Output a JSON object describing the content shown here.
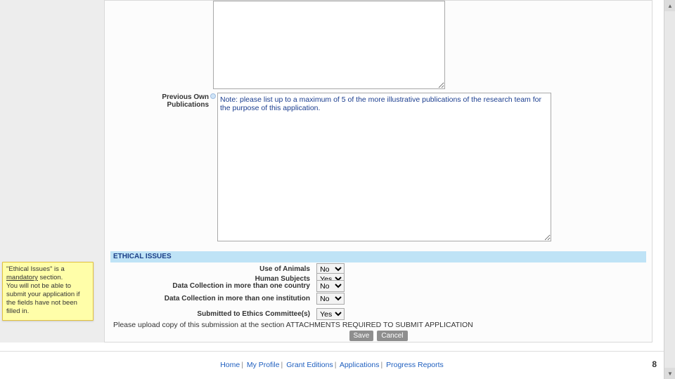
{
  "form": {
    "prev_own_publications_label": "Previous Own Publications",
    "prev_textarea_content": "Note: please list up to a maximum of 5 of the more illustrative publications of the research team for the purpose of this application."
  },
  "ethical": {
    "section_title": "ETHICAL ISSUES",
    "rows": [
      {
        "label": "Use of Animals",
        "value": "No"
      },
      {
        "label": "Human Subjects",
        "value": "Yes"
      },
      {
        "label": "Data Collection in more than one country",
        "value": "No"
      },
      {
        "label": "Data Collection in more than one institution",
        "value": "No"
      },
      {
        "label": "Submitted to Ethics Committee(s)",
        "value": "Yes"
      }
    ],
    "upload_note": "Please upload copy of this submission at the section ATTACHMENTS REQUIRED TO SUBMIT APPLICATION"
  },
  "buttons": {
    "save": "Save",
    "cancel": "Cancel"
  },
  "sticky": {
    "line1_a": "\"Ethical Issues\" is a ",
    "line1_u": "mandatory",
    "line1_b": " section.",
    "line2": "You will not be able to submit your application if the fields have not been filled in."
  },
  "footer": {
    "links": [
      "Home",
      "My Profile",
      "Grant Editions",
      "Applications",
      "Progress Reports"
    ],
    "page": "8"
  },
  "select_options": [
    "Yes",
    "No"
  ]
}
